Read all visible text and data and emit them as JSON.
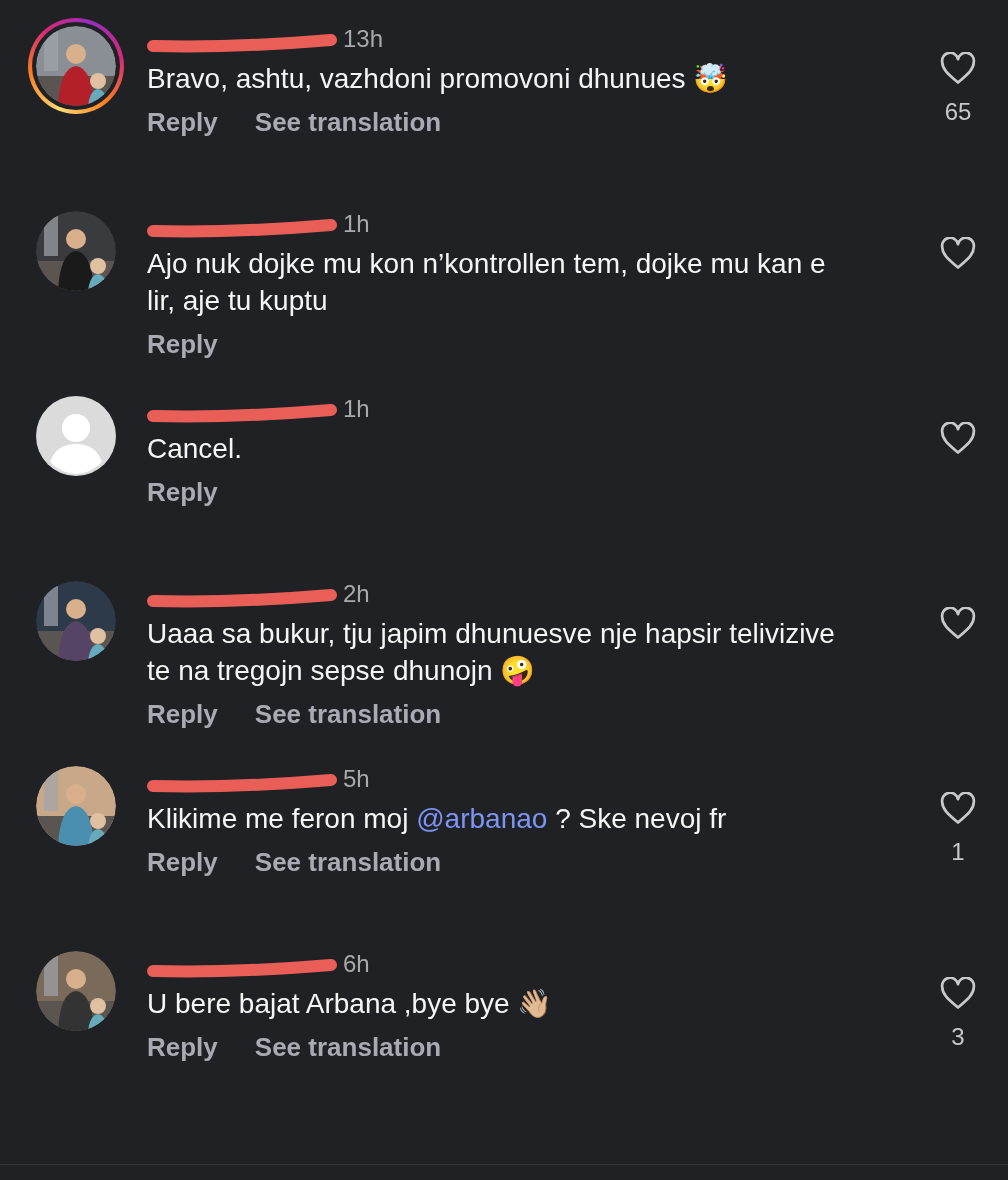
{
  "comments": [
    {
      "avatar": {
        "kind": "picture",
        "story_ring": true
      },
      "time": "13h",
      "text": [
        {
          "text": "Bravo, ashtu, vazhdoni promovoni dhunues 🤯"
        }
      ],
      "actions": [
        "Reply",
        "See translation"
      ],
      "likes": "65"
    },
    {
      "avatar": {
        "kind": "picture",
        "story_ring": false
      },
      "time": "1h",
      "text": [
        {
          "text": "Ajo nuk dojke mu kon n’kontrollen tem, dojke mu kan e lir, aje tu kuptu"
        }
      ],
      "actions": [
        "Reply"
      ]
    },
    {
      "avatar": {
        "kind": "default",
        "story_ring": false
      },
      "time": "1h",
      "text": [
        {
          "text": "Cancel."
        }
      ],
      "actions": [
        "Reply"
      ]
    },
    {
      "avatar": {
        "kind": "picture",
        "story_ring": false
      },
      "time": "2h",
      "text": [
        {
          "text": "Uaaa sa bukur, tju japim dhunuesve nje hapsir telivizive te na tregojn sepse dhunojn 🤪"
        }
      ],
      "actions": [
        "Reply",
        "See translation"
      ]
    },
    {
      "avatar": {
        "kind": "picture",
        "story_ring": false
      },
      "time": "5h",
      "text": [
        {
          "text": "Klikime me feron moj "
        },
        {
          "text": "@arbanao",
          "kind": "mention"
        },
        {
          "text": " ? Ske nevoj fr"
        }
      ],
      "actions": [
        "Reply",
        "See translation"
      ],
      "likes": "1"
    },
    {
      "avatar": {
        "kind": "picture",
        "story_ring": false
      },
      "time": "6h",
      "text": [
        {
          "text": "U bere bajat Arbana ,bye bye 👋🏼"
        }
      ],
      "actions": [
        "Reply",
        "See translation"
      ],
      "likes": "3"
    }
  ]
}
